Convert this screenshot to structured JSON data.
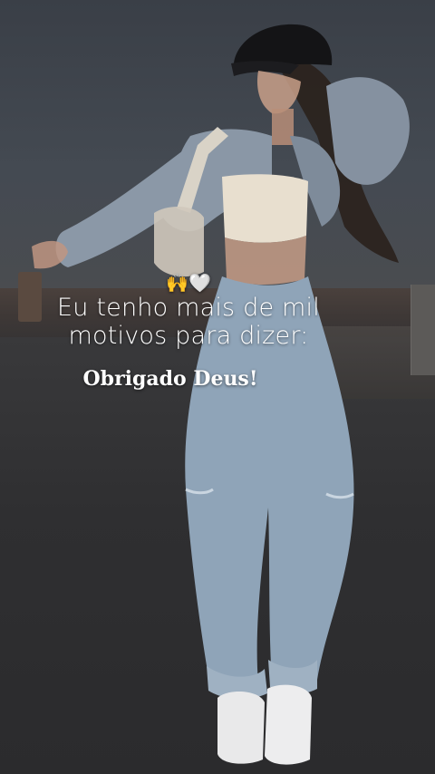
{
  "caption": {
    "emoji": "🙌🤍",
    "line1": "Eu tenho mais de mil",
    "line2": "motivos para dizer:",
    "headline": "Obrigado Deus!"
  },
  "colors": {
    "text": "#ffffff",
    "overlay": "#2b2c2e"
  }
}
